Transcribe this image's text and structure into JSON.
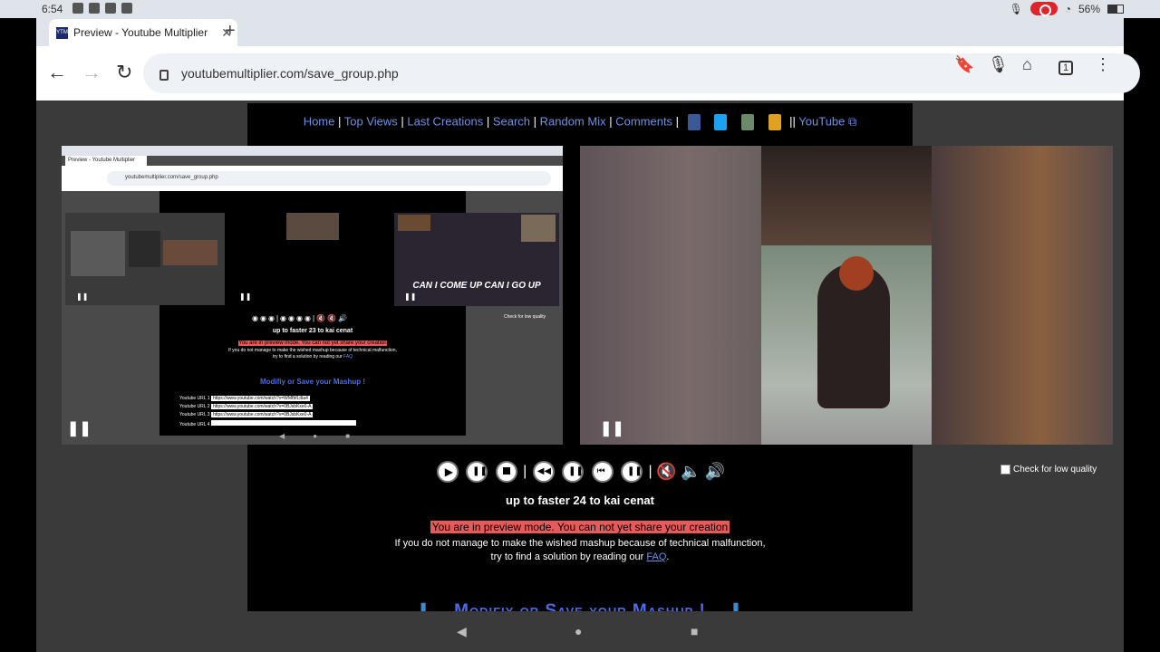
{
  "status": {
    "time": "6:54",
    "battery": "56%"
  },
  "tab": {
    "title": "Preview - Youtube Multiplier",
    "favicon_text": "YTM"
  },
  "address": {
    "url": "youtubemultiplier.com/save_group.php",
    "tab_count": "1"
  },
  "nav": {
    "links": [
      "Home",
      "Top Views",
      "Last Creations",
      "Search",
      "Random Mix",
      "Comments"
    ],
    "youtube": "YouTube"
  },
  "controls": {
    "low_quality": "Check for low quality"
  },
  "caption": "up to faster 24 to kai cenat",
  "warning": "You are in preview mode. You can not yet share your creation",
  "help": {
    "line1": "If you do not manage to make the wished mashup because of technical malfunction,",
    "line2_prefix": "try to find a solution by reading our",
    "faq": "FAQ",
    "line2_suffix": "."
  },
  "section_title": "Modifiy or Save your Mashup !",
  "embedded": {
    "caption": "up to faster 23 to kai cenat",
    "overlay_text": "CAN I COME UP CAN I GO UP",
    "low_quality": "Check for low quality",
    "url_rows": [
      {
        "label": "Youtube URL 1",
        "value": "https://www.youtube.com/watch?v=WMfbfLtIia4"
      },
      {
        "label": "Youtube URL 2",
        "value": "https://www.youtube.com/watch?v=0BJsbKxe0-A"
      },
      {
        "label": "Youtube URL 3",
        "value": "https://www.youtube.com/watch?v=0BJsbKxe0-A"
      },
      {
        "label": "Youtube URL 4",
        "value": ""
      }
    ]
  },
  "colors": {
    "link": "#7090e8",
    "warning_bg": "#e65a5a",
    "title_blue": "#4b6be6"
  }
}
